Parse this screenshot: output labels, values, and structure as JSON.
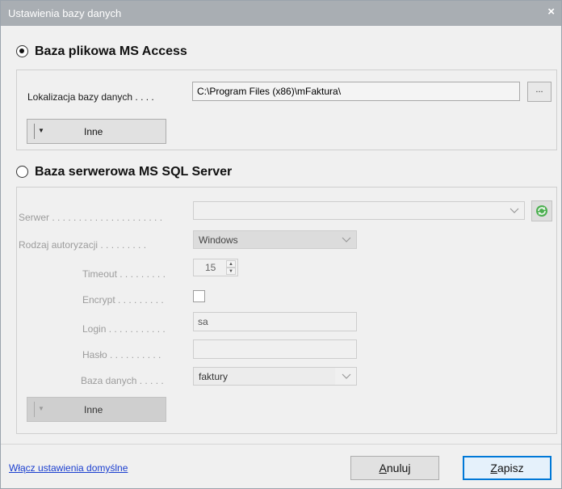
{
  "window": {
    "title": "Ustawienia bazy danych",
    "close_glyph": "×"
  },
  "access": {
    "heading": "Baza plikowa MS Access",
    "selected": true,
    "location_label": "Lokalizacja bazy danych . . . .",
    "location_value": "C:\\Program Files (x86)\\mFaktura\\",
    "browse_label": "...",
    "more_label": "Inne"
  },
  "sql": {
    "heading": "Baza serwerowa MS SQL Server",
    "selected": false,
    "server_label": "Serwer . . . . . . . . . . . . . . . . . . . . .",
    "server_value": "",
    "auth_label": "Rodzaj autoryzacji . . . . . . . . .",
    "auth_value": "Windows",
    "timeout_label": "Timeout . . . . . . . . .",
    "timeout_value": "15",
    "encrypt_label": "Encrypt . . . . . . . . .",
    "encrypt_checked": false,
    "login_label": "Login . . . . . . . . . . .",
    "login_value": "sa",
    "password_label": "Hasło . . . . . . . . . .",
    "password_value": "",
    "database_label": "Baza danych . . . . .",
    "database_value": "faktury",
    "more_label": "Inne"
  },
  "footer": {
    "defaults_link": "Włącz ustawienia domyślne",
    "cancel_label": "Anuluj",
    "cancel_accel": "A",
    "cancel_rest": "nuluj",
    "save_label": "Zapisz",
    "save_accel": "Z",
    "save_rest": "apisz"
  },
  "icons": {
    "refresh": "refresh-icon",
    "chevron": "chevron-down-icon",
    "dropdown_arrow": "dropdown-arrow-icon"
  },
  "colors": {
    "titlebar": "#a9aeb3",
    "link": "#1a3ecf",
    "primary_border": "#0078d7",
    "refresh_green": "#3c9d3c"
  }
}
